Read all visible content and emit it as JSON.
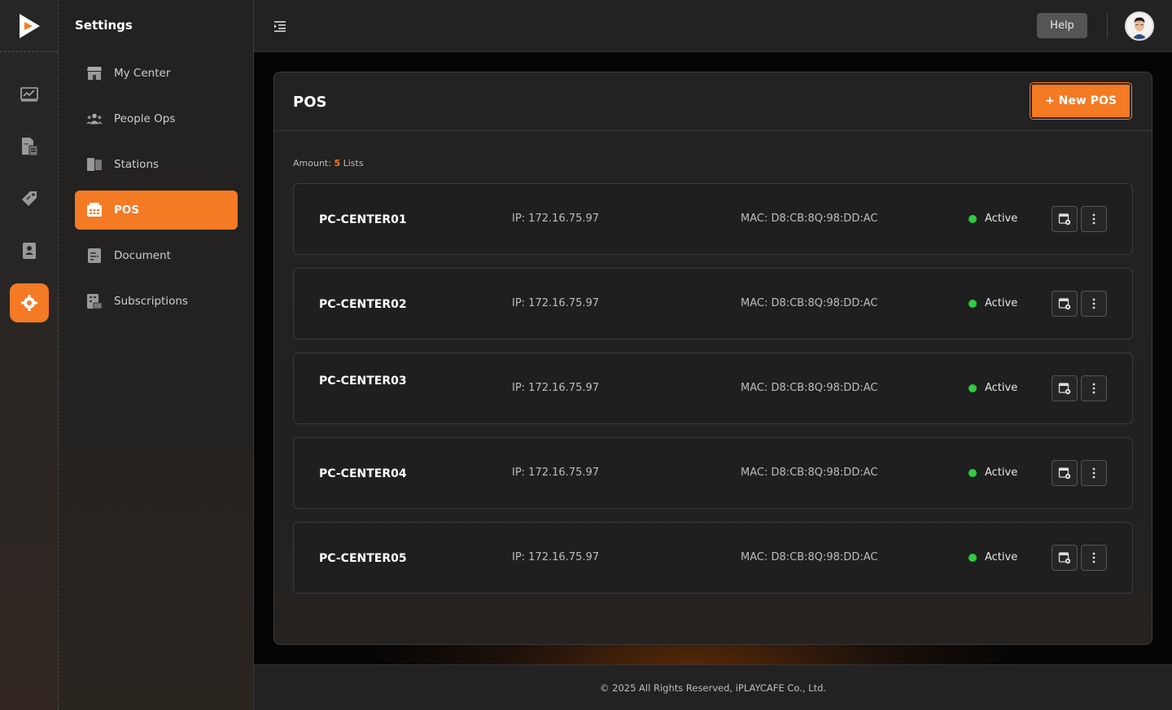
{
  "colors": {
    "accent": "#f47a24",
    "active_dot": "#2ecc40"
  },
  "rail": {
    "logo": "play-logo-icon",
    "items": [
      {
        "icon": "chart-icon"
      },
      {
        "icon": "report-icon"
      },
      {
        "icon": "tag-icon"
      },
      {
        "icon": "contact-icon"
      },
      {
        "icon": "gear-icon",
        "active": true
      }
    ]
  },
  "settings": {
    "title": "Settings",
    "items": [
      {
        "label": "My Center",
        "icon": "store-icon"
      },
      {
        "label": "People Ops",
        "icon": "people-icon"
      },
      {
        "label": "Stations",
        "icon": "station-icon"
      },
      {
        "label": "POS",
        "icon": "pos-icon",
        "active": true
      },
      {
        "label": "Document",
        "icon": "document-icon"
      },
      {
        "label": "Subscriptions",
        "icon": "subscription-icon"
      }
    ]
  },
  "topbar": {
    "help_label": "Help",
    "menu_icon": "collapse-menu-icon"
  },
  "main": {
    "title": "POS",
    "new_button": "+ New POS",
    "amount_label": "Amount:",
    "amount_count": "5",
    "amount_unit": "Lists",
    "rows": [
      {
        "name": "PC-CENTER01",
        "ip": "IP: 172.16.75.97",
        "mac": "MAC: D8:CB:8Q:98:DD:AC",
        "status": "Active"
      },
      {
        "name": "PC-CENTER02",
        "ip": "IP: 172.16.75.97",
        "mac": "MAC: D8:CB:8Q:98:DD:AC",
        "status": "Active"
      },
      {
        "name": "PC-CENTER03",
        "ip": "IP: 172.16.75.97",
        "mac": "MAC: D8:CB:8Q:98:DD:AC",
        "status": "Active"
      },
      {
        "name": "PC-CENTER04",
        "ip": "IP: 172.16.75.97",
        "mac": "MAC: D8:CB:8Q:98:DD:AC",
        "status": "Active"
      },
      {
        "name": "PC-CENTER05",
        "ip": "IP: 172.16.75.97",
        "mac": "MAC: D8:CB:8Q:98:DD:AC",
        "status": "Active"
      }
    ]
  },
  "footer": {
    "copyright": "© 2025 All Rights Reserved, iPLAYCAFE Co., Ltd."
  }
}
